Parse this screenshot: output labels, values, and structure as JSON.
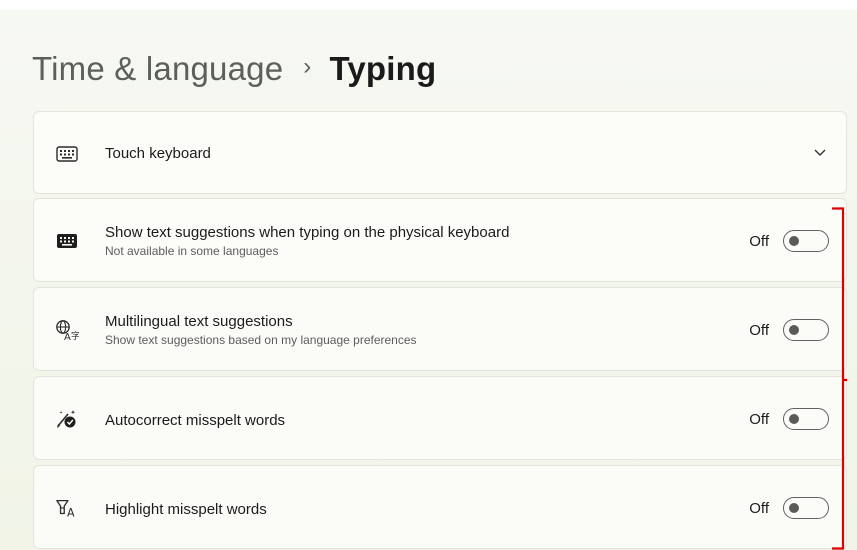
{
  "header": {
    "parent": "Time & language",
    "separator": "›",
    "current": "Typing"
  },
  "touch_keyboard": {
    "label": "Touch keyboard",
    "icon": "keyboard-outline-icon",
    "expander_icon": "chevron-down-icon"
  },
  "settings": [
    {
      "label": "Show text suggestions when typing on the physical keyboard",
      "sub": "Not available in some languages",
      "state": "Off",
      "on": false,
      "icon": "keyboard-filled-icon"
    },
    {
      "label": "Multilingual text suggestions",
      "sub": "Show text suggestions based on my language preferences",
      "state": "Off",
      "on": false,
      "icon": "globe-language-icon"
    },
    {
      "label": "Autocorrect misspelt words",
      "sub": "",
      "state": "Off",
      "on": false,
      "icon": "autocorrect-pen-icon"
    },
    {
      "label": "Highlight misspelt words",
      "sub": "",
      "state": "Off",
      "on": false,
      "icon": "highlight-text-icon"
    }
  ],
  "annotation": {
    "color": "#e00000"
  }
}
